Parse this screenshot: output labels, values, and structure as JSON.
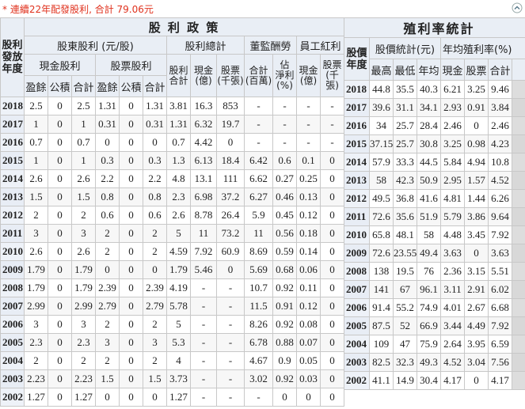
{
  "note": "* 連續22年配發股利, 合計 79.06元",
  "policy": {
    "title": "股 利 政 策",
    "year_header": "股利\n發放\n年度",
    "group_shareholder": "股東股利 (元/股)",
    "group_total": "股利總計",
    "group_supervisor": "董監酬勞",
    "group_employee": "員工紅利",
    "sub_cash": "現金股利",
    "sub_stock": "股票股利",
    "leaf": {
      "surplus": "盈餘",
      "reserve": "公積",
      "total": "合計",
      "div_total": "股利\n合計",
      "cash_yi": "現金\n(億)",
      "stock_kz": "股票\n(千張)",
      "total_bw": "合計\n(百萬)",
      "est_ratio": "佔\n淨利\n(%)",
      "emp_cash": "現金\n(億)",
      "emp_stock": "股票\n(千張)"
    },
    "rows": [
      [
        "2018",
        "2.5",
        "0",
        "2.5",
        "1.31",
        "0",
        "1.31",
        "3.81",
        "16.3",
        "853",
        "-",
        "-",
        "-",
        "-"
      ],
      [
        "2017",
        "1",
        "0",
        "1",
        "0.31",
        "0",
        "0.31",
        "1.31",
        "6.32",
        "19.7",
        "-",
        "-",
        "-",
        "-"
      ],
      [
        "2016",
        "0.7",
        "0",
        "0.7",
        "0",
        "0",
        "0",
        "0.7",
        "4.42",
        "0",
        "-",
        "-",
        "-",
        "-"
      ],
      [
        "2015",
        "1",
        "0",
        "1",
        "0.3",
        "0",
        "0.3",
        "1.3",
        "6.13",
        "18.4",
        "6.42",
        "0.6",
        "0.1",
        "0"
      ],
      [
        "2014",
        "2.6",
        "0",
        "2.6",
        "2.2",
        "0",
        "2.2",
        "4.8",
        "13.1",
        "111",
        "6.62",
        "0.27",
        "0.25",
        "0"
      ],
      [
        "2013",
        "1.5",
        "0",
        "1.5",
        "0.8",
        "0",
        "0.8",
        "2.3",
        "6.98",
        "37.2",
        "6.27",
        "0.46",
        "0.13",
        "0"
      ],
      [
        "2012",
        "2",
        "0",
        "2",
        "0.6",
        "0",
        "0.6",
        "2.6",
        "8.78",
        "26.4",
        "5.9",
        "0.45",
        "0.12",
        "0"
      ],
      [
        "2011",
        "3",
        "0",
        "3",
        "2",
        "0",
        "2",
        "5",
        "11",
        "73.2",
        "11",
        "0.56",
        "0.18",
        "0"
      ],
      [
        "2010",
        "2.6",
        "0",
        "2.6",
        "2",
        "0",
        "2",
        "4.59",
        "7.92",
        "60.9",
        "8.69",
        "0.59",
        "0.14",
        "0"
      ],
      [
        "2009",
        "1.79",
        "0",
        "1.79",
        "0",
        "0",
        "0",
        "1.79",
        "5.46",
        "0",
        "5.69",
        "0.68",
        "0.06",
        "0"
      ],
      [
        "2008",
        "1.79",
        "0",
        "1.79",
        "2.39",
        "0",
        "2.39",
        "4.19",
        "-",
        "-",
        "10.7",
        "0.92",
        "0.11",
        "0"
      ],
      [
        "2007",
        "2.99",
        "0",
        "2.99",
        "2.79",
        "0",
        "2.79",
        "5.78",
        "-",
        "-",
        "11.5",
        "0.91",
        "0.12",
        "0"
      ],
      [
        "2006",
        "3",
        "0",
        "3",
        "2",
        "0",
        "2",
        "5",
        "-",
        "-",
        "8.26",
        "0.92",
        "0.08",
        "0"
      ],
      [
        "2005",
        "2.3",
        "0",
        "2.3",
        "3",
        "0",
        "3",
        "5.3",
        "-",
        "-",
        "6.78",
        "0.88",
        "0.07",
        "0"
      ],
      [
        "2004",
        "2",
        "0",
        "2",
        "2",
        "0",
        "2",
        "4",
        "-",
        "-",
        "4.67",
        "0.9",
        "0.05",
        "0"
      ],
      [
        "2003",
        "2.23",
        "0",
        "2.23",
        "1.5",
        "0",
        "1.5",
        "3.73",
        "-",
        "-",
        "3.02",
        "0.92",
        "0.03",
        "0"
      ],
      [
        "2002",
        "1.27",
        "0",
        "1.27",
        "0",
        "0",
        "0",
        "1.27",
        "-",
        "-",
        "-",
        "0",
        "0",
        "0"
      ]
    ]
  },
  "yield": {
    "title": "殖利率統計",
    "year_header": "股價\n年度",
    "group_price": "股價統計(元)",
    "group_yield": "年均殖利率(%)",
    "leaf": {
      "high": "最高",
      "low": "最低",
      "avg": "年均",
      "cash": "現金",
      "stock": "股票",
      "total": "合計"
    },
    "rows": [
      [
        "2018",
        "44.8",
        "35.5",
        "40.3",
        "6.21",
        "3.25",
        "9.46"
      ],
      [
        "2017",
        "39.6",
        "31.1",
        "34.1",
        "2.93",
        "0.91",
        "3.84"
      ],
      [
        "2016",
        "34",
        "25.7",
        "28.4",
        "2.46",
        "0",
        "2.46"
      ],
      [
        "2015",
        "37.15",
        "25.7",
        "30.8",
        "3.25",
        "0.98",
        "4.23"
      ],
      [
        "2014",
        "57.9",
        "33.3",
        "44.5",
        "5.84",
        "4.94",
        "10.8"
      ],
      [
        "2013",
        "58",
        "42.3",
        "50.9",
        "2.95",
        "1.57",
        "4.52"
      ],
      [
        "2012",
        "49.5",
        "36.8",
        "41.6",
        "4.81",
        "1.44",
        "6.26"
      ],
      [
        "2011",
        "72.6",
        "35.6",
        "51.9",
        "5.79",
        "3.86",
        "9.64"
      ],
      [
        "2010",
        "65.8",
        "48.1",
        "58",
        "4.48",
        "3.45",
        "7.92"
      ],
      [
        "2009",
        "72.6",
        "23.55",
        "49.4",
        "3.63",
        "0",
        "3.63"
      ],
      [
        "2008",
        "138",
        "19.5",
        "76",
        "2.36",
        "3.15",
        "5.51"
      ],
      [
        "2007",
        "141",
        "67",
        "96.1",
        "3.11",
        "2.91",
        "6.02"
      ],
      [
        "2006",
        "91.4",
        "55.2",
        "74.9",
        "4.01",
        "2.67",
        "6.68"
      ],
      [
        "2005",
        "87.5",
        "52",
        "66.9",
        "3.44",
        "4.49",
        "7.92"
      ],
      [
        "2004",
        "109",
        "47",
        "75.9",
        "2.64",
        "3.95",
        "6.59"
      ],
      [
        "2003",
        "82.5",
        "32.3",
        "49.3",
        "4.52",
        "3.04",
        "7.56"
      ],
      [
        "2002",
        "41.1",
        "14.9",
        "30.4",
        "4.17",
        "0",
        "4.17"
      ]
    ]
  },
  "colors": {
    "note": "#e0321e",
    "header_bg": "#e9eef5",
    "border": "#c8c8c8"
  },
  "icons": {
    "collapse": "collapse-up-icon"
  }
}
